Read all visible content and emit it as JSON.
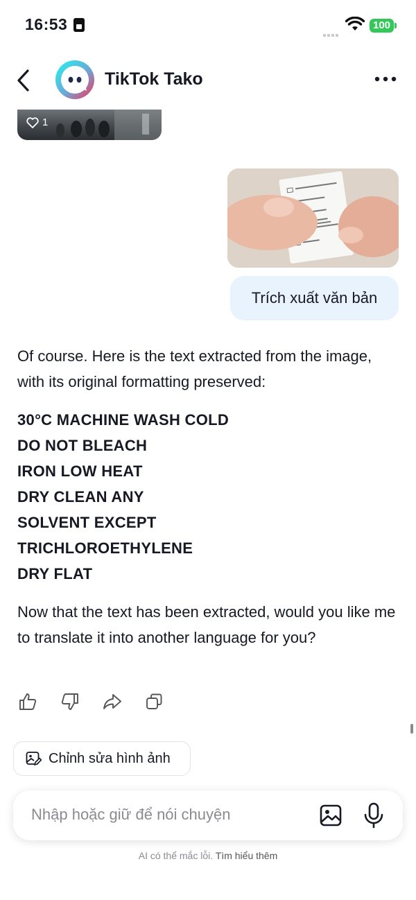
{
  "status_bar": {
    "time": "16:53",
    "battery": "100"
  },
  "header": {
    "title": "TikTok Tako"
  },
  "previous_image": {
    "like_count": "1"
  },
  "user_message": {
    "text": "Trích xuất văn bản"
  },
  "bot_reply": {
    "intro": "Of course. Here is the text extracted from the image, with its original formatting preserved:",
    "extracted_lines": [
      "30°C MACHINE WASH COLD",
      "DO NOT BLEACH",
      "IRON LOW HEAT",
      "DRY CLEAN ANY",
      "SOLVENT EXCEPT",
      "TRICHLOROETHYLENE",
      "DRY FLAT"
    ],
    "outro": "Now that the text has been extracted, would you like me to translate it into another language for you?"
  },
  "suggestion_chip": {
    "label": "Chỉnh sửa hình ảnh"
  },
  "input": {
    "placeholder": "Nhập hoặc giữ để nói chuyện"
  },
  "disclaimer": {
    "text": "AI có thể mắc lỗi.",
    "link": "Tìm hiểu thêm"
  },
  "colors": {
    "user_bubble": "#e8f3fd",
    "battery": "#34c759",
    "brand_cyan": "#25f4ee",
    "brand_red": "#fe2c55"
  }
}
